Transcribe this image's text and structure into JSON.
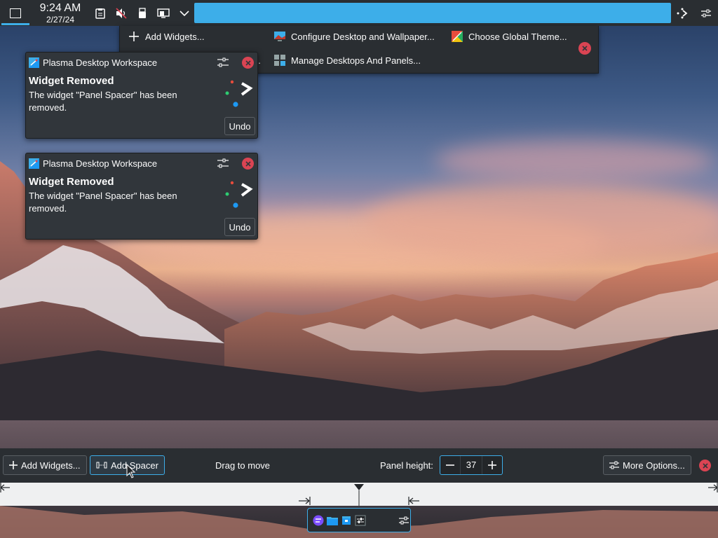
{
  "top_panel": {
    "clock_time": "9:24 AM",
    "clock_date": "2/27/24",
    "icons": [
      "show-desktop-icon",
      "clipboard-icon",
      "volume-muted-icon",
      "usb-device-icon",
      "display-icon",
      "chevron-down-icon",
      "edit-mode-icon",
      "settings-sliders-icon"
    ],
    "highlight_color": "#3daee9"
  },
  "edit_toolbar": {
    "add_widgets": "Add Widgets...",
    "configure_desktop": "Configure Desktop and Wallpaper...",
    "choose_theme": "Choose Global Theme...",
    "manage_desktops": "Manage Desktops And Panels...",
    "truncated_item": "..."
  },
  "notifications": [
    {
      "app": "Plasma Desktop Workspace",
      "title": "Widget Removed",
      "body": "The widget \"Panel Spacer\" has been removed.",
      "action": "Undo"
    },
    {
      "app": "Plasma Desktop Workspace",
      "title": "Widget Removed",
      "body": "The widget \"Panel Spacer\" has been removed.",
      "action": "Undo"
    }
  ],
  "panel_config": {
    "add_widgets": "Add Widgets...",
    "add_spacer": "Add Spacer",
    "drag_to_move": "Drag to move",
    "panel_height_label": "Panel height:",
    "panel_height_value": "37",
    "more_options": "More Options..."
  },
  "colors": {
    "panel_bg": "#2a2e32",
    "accent": "#3daee9",
    "close_red": "#da4453",
    "ruler_bg": "#eff0f1"
  }
}
